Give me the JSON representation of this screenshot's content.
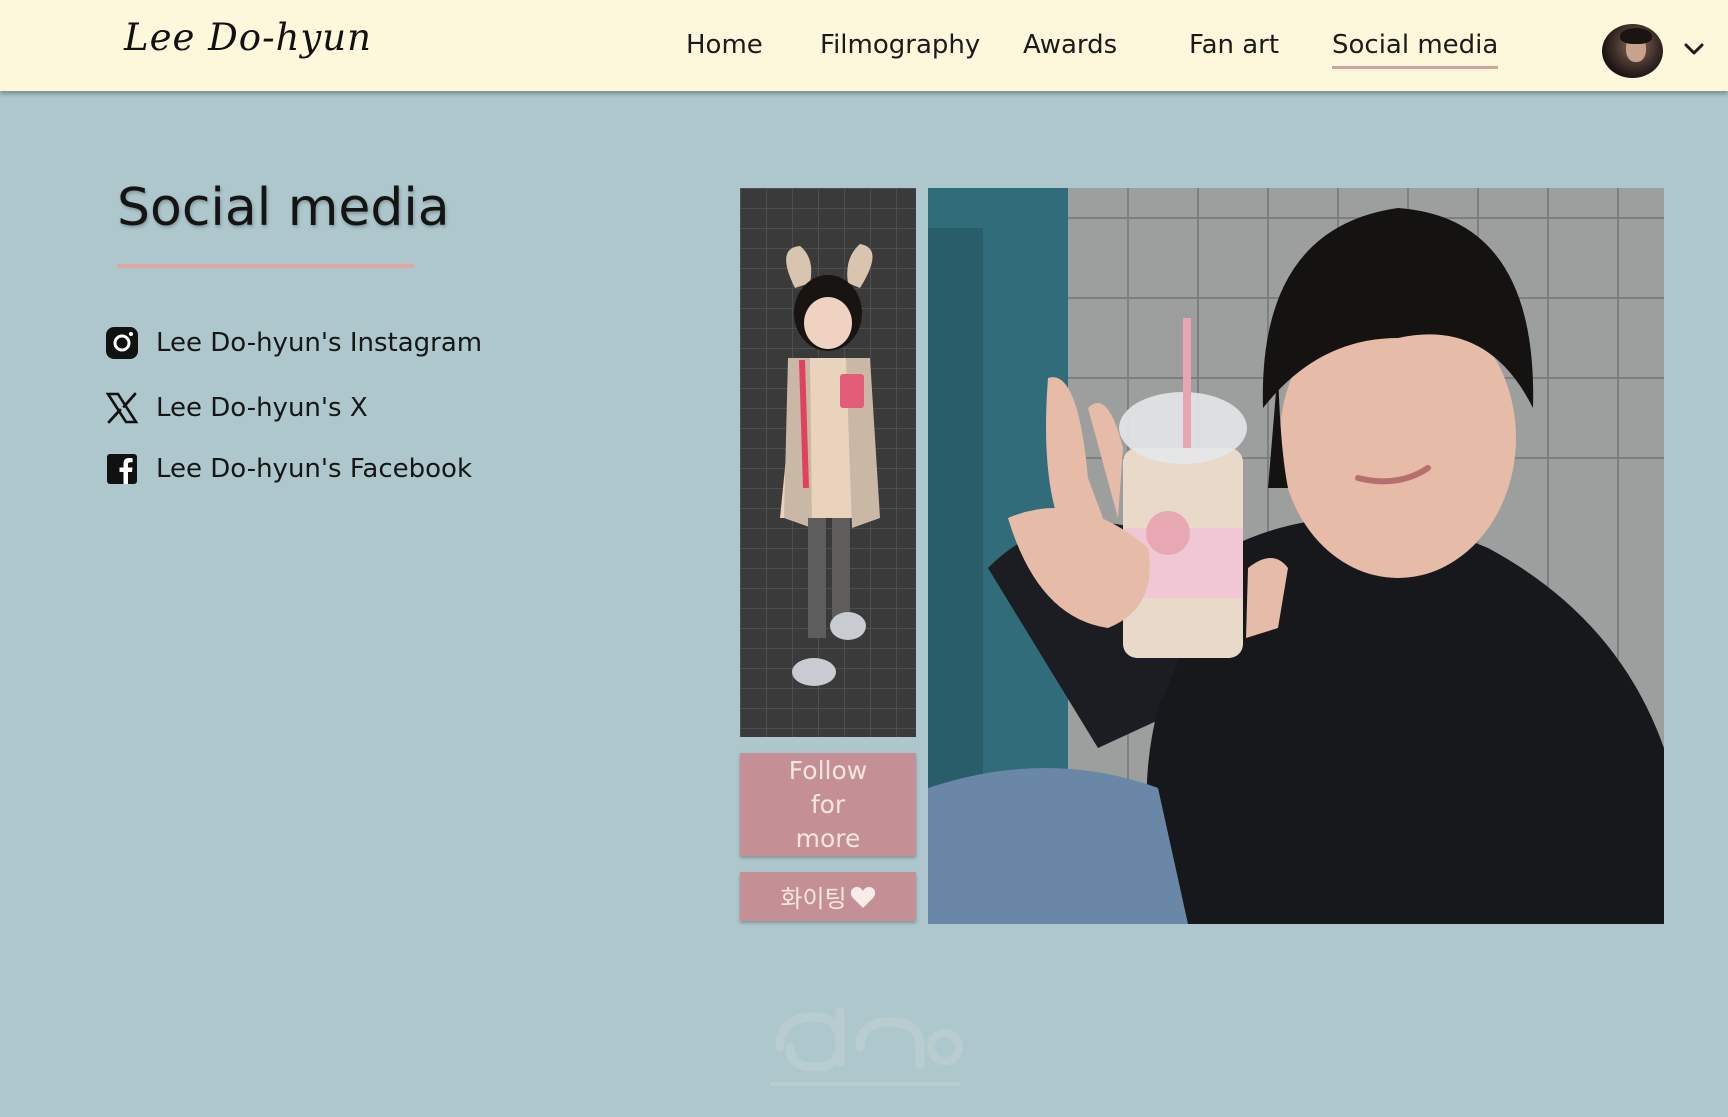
{
  "header": {
    "logo": "Lee Do-hyun",
    "nav": [
      {
        "label": "Home"
      },
      {
        "label": "Filmography"
      },
      {
        "label": "Awards"
      },
      {
        "label": "Fan art"
      },
      {
        "label": "Social media",
        "active": true
      }
    ],
    "avatar_icon": "profile-photo",
    "menu_icon": "chevron-down-icon"
  },
  "main": {
    "title": "Social media",
    "links": [
      {
        "label": "Lee Do-hyun's Instagram",
        "icon": "instagram-icon"
      },
      {
        "label": "Lee Do-hyun's X",
        "icon": "x-icon"
      },
      {
        "label": "Lee Do-hyun's Facebook",
        "icon": "facebook-icon"
      }
    ],
    "follow_button": "Follow for more",
    "fighting_button": "화이팅",
    "fighting_icon": "heart-icon"
  },
  "colors": {
    "background": "#adc7cd",
    "header_bg": "#fdf8dc",
    "accent_line": "#e2a6a2",
    "button_bg": "#c49095",
    "button_text": "#f3e7e3"
  }
}
